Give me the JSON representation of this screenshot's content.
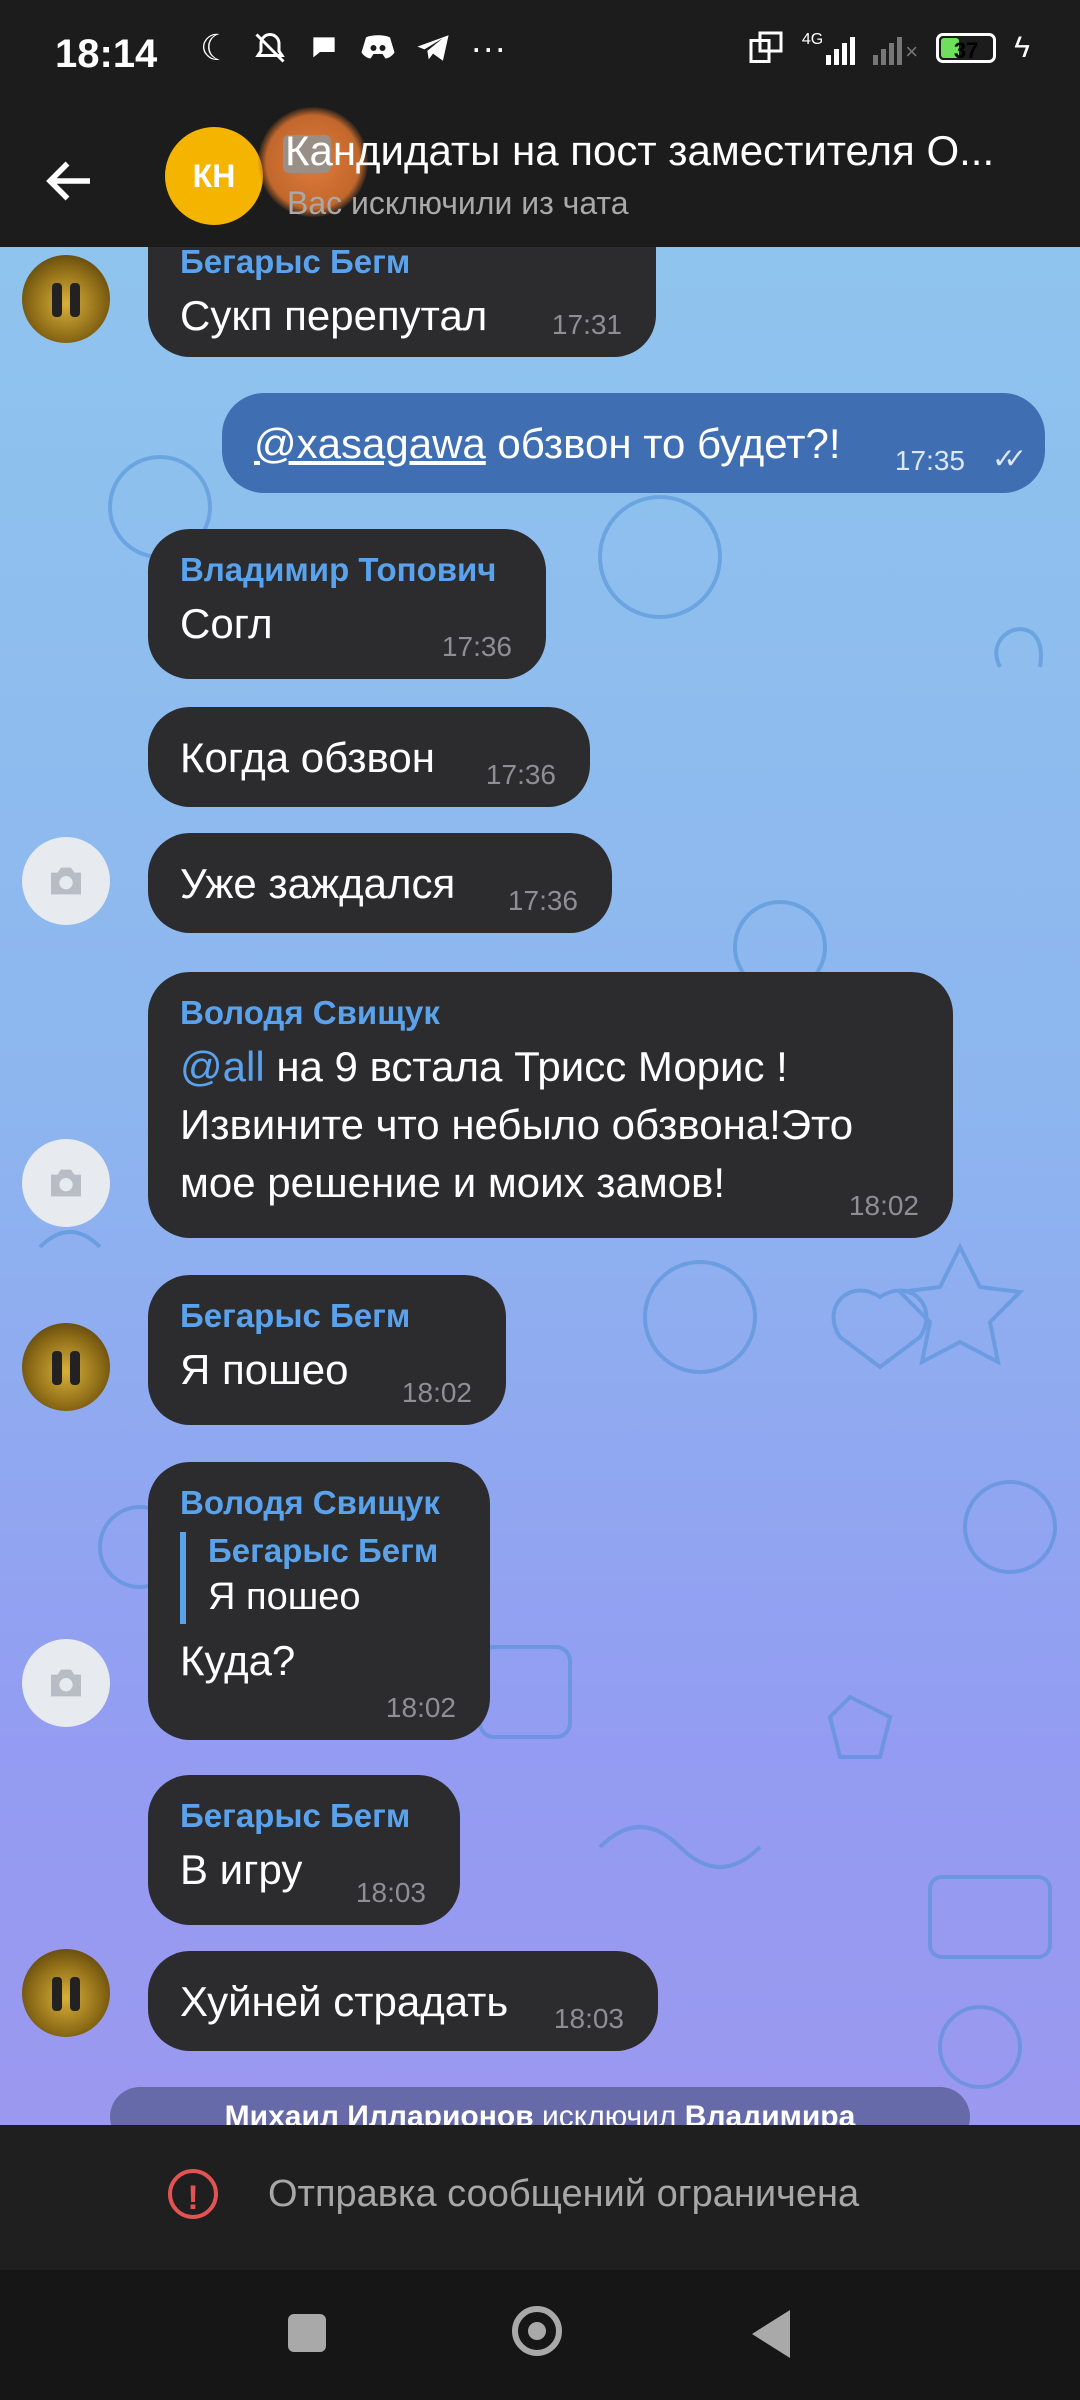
{
  "status_bar": {
    "time": "18:14",
    "network": "4G",
    "battery": "37",
    "left_icons": [
      "moon-icon",
      "bell-off-icon",
      "chat-icon",
      "discord-icon",
      "telegram-icon",
      "more-icon"
    ]
  },
  "header": {
    "avatar_initials": "КН",
    "title": "Кандидаты на пост заместителя О...",
    "subtitle": "Вас исключили из чата"
  },
  "messages": [
    {
      "sender": "Бегарыс Бегм",
      "text": "Сукп перепутал",
      "time": "17:31"
    },
    {
      "mention": "@xasagawa",
      "text": " обзвон то будет?!",
      "time": "17:35",
      "outgoing": true
    },
    {
      "sender": "Владимир Топович",
      "text": "Согл",
      "time": "17:36"
    },
    {
      "text": "Когда обзвон",
      "time": "17:36"
    },
    {
      "text": "Уже заждался",
      "time": "17:36"
    },
    {
      "sender": "Володя Свищук",
      "mention": "@all",
      "text": " на 9 встала Трисс Морис !",
      "line2": "Извините что небыло обзвона!Это",
      "line3": "мое решение и моих замов!",
      "time": "18:02"
    },
    {
      "sender": "Бегарыс Бегм",
      "text": "Я пошео",
      "time": "18:02"
    },
    {
      "sender": "Володя Свищук",
      "reply_name": "Бегарыс Бегм",
      "reply_text": "Я пошео",
      "text": "Куда?",
      "time": "18:02"
    },
    {
      "sender": "Бегарыс Бегм",
      "text": "В игру",
      "time": "18:03"
    },
    {
      "text": "Хуйней страдать",
      "time": "18:03"
    }
  ],
  "service_message": {
    "name1": "Михаил Илларионов",
    "action": " исключил ",
    "name2": "Владимира"
  },
  "restricted": {
    "text": "Отправка сообщений ограничена"
  },
  "colors": {
    "accent": "#5aa2ec",
    "bubble_in": "#2c2c2e",
    "bubble_out": "#3f6fb2",
    "warning": "#e35354"
  }
}
